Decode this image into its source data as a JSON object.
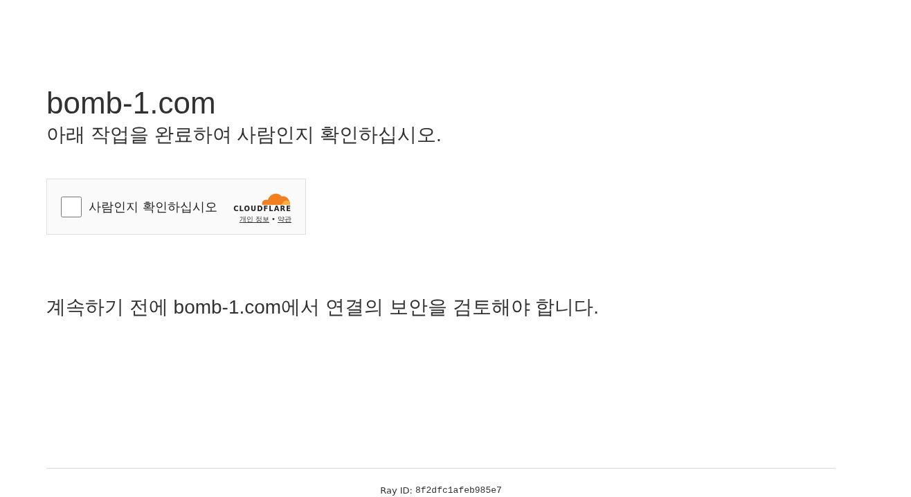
{
  "site_title": "bomb-1.com",
  "subtitle": "아래 작업을 완료하여 사람인지 확인하십시오.",
  "widget": {
    "checkbox": {
      "label": "사람인지 확인하십시오",
      "checked": false
    },
    "logo_text": "CLOUDFLARE",
    "links": [
      "개인 정보",
      "약관"
    ],
    "separator": "•"
  },
  "message": "계속하기 전에 bomb-1.com에서 연결의 보안을 검토해야 합니다.",
  "footer": {
    "label": "Ray ID:",
    "ray_id": "8f2dfc1afeb985e7"
  }
}
